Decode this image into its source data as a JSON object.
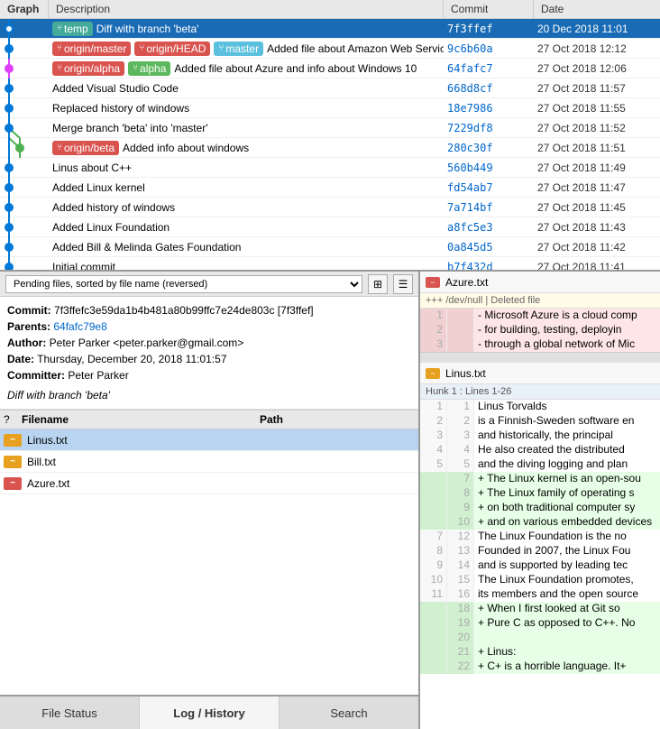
{
  "header": {
    "graph": "Graph",
    "description": "Description",
    "commit": "Commit",
    "date": "Date"
  },
  "log_rows": [
    {
      "id": 0,
      "selected": true,
      "branches": [
        {
          "label": "temp",
          "type": "local"
        },
        {
          "label": "Diff with branch 'beta'",
          "type": "desc-only"
        }
      ],
      "desc": "Diff with branch 'beta'",
      "commit": "7f3ffef",
      "date": "20 Dec 2018 11:01",
      "graph_dot": {
        "x": 10,
        "color": "#0078d7",
        "col": 0
      }
    },
    {
      "id": 1,
      "selected": false,
      "branches": [
        {
          "label": "origin/master",
          "type": "origin"
        },
        {
          "label": "origin/HEAD",
          "type": "origin"
        },
        {
          "label": "master",
          "type": "master"
        }
      ],
      "desc": "Added file about Amazon Web Services",
      "commit": "9c6b60a",
      "date": "27 Oct 2018 12:12",
      "graph_dot": {
        "x": 10,
        "color": "#0078d7",
        "col": 0
      }
    },
    {
      "id": 2,
      "selected": false,
      "branches": [
        {
          "label": "origin/alpha",
          "type": "origin"
        },
        {
          "label": "alpha",
          "type": "alpha"
        }
      ],
      "desc": "Added file about Azure and info about Windows 10",
      "commit": "64fafc7",
      "date": "27 Oct 2018 12:06",
      "graph_dot": {
        "x": 10,
        "color": "#e040fb",
        "col": 0
      }
    },
    {
      "id": 3,
      "selected": false,
      "branches": [],
      "desc": "Added Visual Studio Code",
      "commit": "668d8cf",
      "date": "27 Oct 2018 11:57",
      "graph_dot": {
        "x": 10,
        "color": "#0078d7",
        "col": 0
      }
    },
    {
      "id": 4,
      "selected": false,
      "branches": [],
      "desc": "Replaced history of windows",
      "commit": "18e7986",
      "date": "27 Oct 2018 11:55",
      "graph_dot": {
        "x": 10,
        "color": "#0078d7",
        "col": 0
      }
    },
    {
      "id": 5,
      "selected": false,
      "branches": [],
      "desc": "Merge branch 'beta' into 'master'",
      "commit": "7229df8",
      "date": "27 Oct 2018 11:52",
      "graph_dot": {
        "x": 10,
        "color": "#0078d7",
        "col": 0
      }
    },
    {
      "id": 6,
      "selected": false,
      "branches": [
        {
          "label": "origin/beta",
          "type": "origin"
        }
      ],
      "desc": "Added info about windows",
      "commit": "280c30f",
      "date": "27 Oct 2018 11:51",
      "graph_dot": {
        "x": 22,
        "color": "#4caf50",
        "col": 1
      }
    },
    {
      "id": 7,
      "selected": false,
      "branches": [],
      "desc": "Linus about C++",
      "commit": "560b449",
      "date": "27 Oct 2018 11:49",
      "graph_dot": {
        "x": 10,
        "color": "#0078d7",
        "col": 0
      }
    },
    {
      "id": 8,
      "selected": false,
      "branches": [],
      "desc": "Added Linux kernel",
      "commit": "fd54ab7",
      "date": "27 Oct 2018 11:47",
      "graph_dot": {
        "x": 10,
        "color": "#0078d7",
        "col": 0
      }
    },
    {
      "id": 9,
      "selected": false,
      "branches": [],
      "desc": "Added history of windows",
      "commit": "7a714bf",
      "date": "27 Oct 2018 11:45",
      "graph_dot": {
        "x": 10,
        "color": "#0078d7",
        "col": 0
      }
    },
    {
      "id": 10,
      "selected": false,
      "branches": [],
      "desc": "Added Linux Foundation",
      "commit": "a8fc5e3",
      "date": "27 Oct 2018 11:43",
      "graph_dot": {
        "x": 10,
        "color": "#0078d7",
        "col": 0
      }
    },
    {
      "id": 11,
      "selected": false,
      "branches": [],
      "desc": "Added Bill & Melinda Gates Foundation",
      "commit": "0a845d5",
      "date": "27 Oct 2018 11:42",
      "graph_dot": {
        "x": 10,
        "color": "#0078d7",
        "col": 0
      }
    },
    {
      "id": 12,
      "selected": false,
      "branches": [],
      "desc": "Initial commit",
      "commit": "b7f432d",
      "date": "27 Oct 2018 11:41",
      "graph_dot": {
        "x": 10,
        "color": "#0078d7",
        "col": 0
      }
    }
  ],
  "pending_bar": {
    "label": "Pending files, sorted by file name (reversed)",
    "grid_icon": "⊞",
    "list_icon": "☰"
  },
  "commit_info": {
    "commit_label": "Commit:",
    "commit_hash": "7f3ffefc3e59da1b4b481a80b99ffc7e24de803c [7f3ffef]",
    "parents_label": "Parents:",
    "parents_hash": "64fafc79e8",
    "author_label": "Author:",
    "author": "Peter Parker <peter.parker@gmail.com>",
    "date_label": "Date:",
    "date_val": "Thursday, December 20, 2018 11:01:57",
    "committer_label": "Committer:",
    "committer": "Peter Parker",
    "diff_message": "Diff with branch 'beta'"
  },
  "files_header": {
    "q_col": "?",
    "filename_col": "Filename",
    "path_col": "Path"
  },
  "files": [
    {
      "name": "Linus.txt",
      "path": "",
      "status": "modified",
      "selected": true
    },
    {
      "name": "Bill.txt",
      "path": "",
      "status": "modified",
      "selected": false
    },
    {
      "name": "Azure.txt",
      "path": "",
      "status": "deleted",
      "selected": false
    }
  ],
  "tabs": [
    {
      "label": "File Status",
      "active": false
    },
    {
      "label": "Log / History",
      "active": true
    },
    {
      "label": "Search",
      "active": false
    }
  ],
  "diff_panel": {
    "azure_file": {
      "name": "Azure.txt",
      "icon": "minus",
      "deleted_note": "+++ /dev/null | Deleted file",
      "lines": [
        {
          "old": "1",
          "new": "",
          "type": "removed",
          "content": "  Microsoft Azure is a cloud comp"
        },
        {
          "old": "2",
          "new": "",
          "type": "removed",
          "content": "  for building, testing, deployin"
        },
        {
          "old": "3",
          "new": "",
          "type": "removed",
          "content": "  through a global network of Mic"
        }
      ]
    },
    "linus_file": {
      "name": "Linus.txt",
      "icon": "yellow",
      "hunk_header": "Hunk 1 : Lines 1-26",
      "lines": [
        {
          "old": "1",
          "new": "1",
          "type": "normal",
          "content": "    Linus Torvalds"
        },
        {
          "old": "2",
          "new": "2",
          "type": "normal",
          "content": "    is a Finnish-Sweden software en"
        },
        {
          "old": "3",
          "new": "3",
          "type": "normal",
          "content": "    and historically, the principal"
        },
        {
          "old": "4",
          "new": "4",
          "type": "normal",
          "content": "    He also created the distributed"
        },
        {
          "old": "5",
          "new": "5",
          "type": "normal",
          "content": "    and the diving logging and plan"
        },
        {
          "old": "",
          "new": "7",
          "type": "added",
          "content": "+ The Linux kernel is an open-sou"
        },
        {
          "old": "",
          "new": "8",
          "type": "added",
          "content": "+ The Linux family of operating s"
        },
        {
          "old": "",
          "new": "9",
          "type": "added",
          "content": "+  on both traditional computer sy"
        },
        {
          "old": "",
          "new": "10",
          "type": "added",
          "content": "+ and on various embedded devices"
        },
        {
          "old": "7",
          "new": "12",
          "type": "normal",
          "content": "    The Linux Foundation is the no"
        },
        {
          "old": "8",
          "new": "13",
          "type": "normal",
          "content": "    Founded in 2007, the Linux Fou"
        },
        {
          "old": "9",
          "new": "14",
          "type": "normal",
          "content": "    and is supported by leading tec"
        },
        {
          "old": "10",
          "new": "15",
          "type": "normal",
          "content": "    The Linux Foundation promotes,"
        },
        {
          "old": "11",
          "new": "16",
          "type": "normal",
          "content": "    its members and the open source"
        },
        {
          "old": "",
          "new": "18",
          "type": "added",
          "content": "+ When I first looked at Git so"
        },
        {
          "old": "",
          "new": "19",
          "type": "added",
          "content": "+ Pure C as opposed to C++. No"
        },
        {
          "old": "",
          "new": "20",
          "type": "added",
          "content": ""
        },
        {
          "old": "",
          "new": "21",
          "type": "added",
          "content": "+ Linus:"
        },
        {
          "old": "",
          "new": "22",
          "type": "added",
          "content": "+  C+ is a horrible language. It+"
        }
      ]
    }
  }
}
